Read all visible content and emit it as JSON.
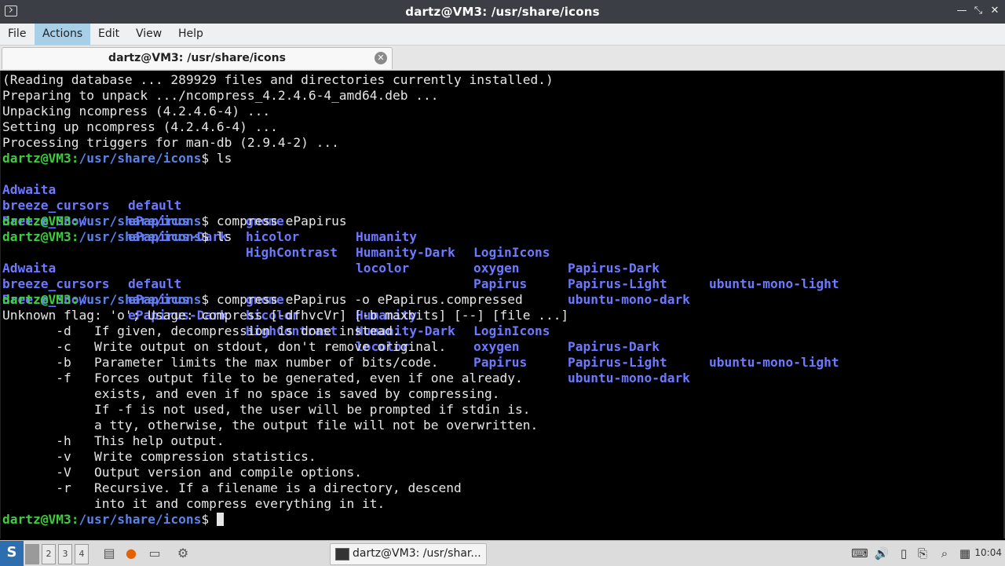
{
  "window": {
    "title": "dartz@VM3: /usr/share/icons"
  },
  "menu": [
    "File",
    "Actions",
    "Edit",
    "View",
    "Help"
  ],
  "tab": {
    "label": "dartz@VM3: /usr/share/icons"
  },
  "terminal": {
    "user_host": "dartz@VM3",
    "path": "/usr/share/icons",
    "output1": [
      "(Reading database ... 289929 files and directories currently installed.)",
      "Preparing to unpack .../ncompress_4.2.4.6-4_amd64.deb ...",
      "Unpacking ncompress (4.2.4.6-4) ...",
      "Setting up ncompress (4.2.4.6-4) ...",
      "Processing triggers for man-db (2.9.4-2) ..."
    ],
    "cmd_ls": "ls",
    "ls_rows": [
      [
        "Adwaita",
        "default",
        "gnome",
        "Humanity",
        "LoginIcons",
        "Papirus-Dark",
        "ubuntu-mono-light"
      ],
      [
        "breeze_cursors",
        "ePapirus",
        "hicolor",
        "Humanity-Dark",
        "oxygen",
        "Papirus-Light",
        ""
      ],
      [
        "Breeze_Snow",
        "ePapirus-Dark",
        "HighContrast",
        "locolor",
        "Papirus",
        "ubuntu-mono-dark",
        ""
      ]
    ],
    "cmd_compress1": "compress ePapirus",
    "cmd_compress2": "compress ePapirus -o ePapirus.compressed",
    "usage": [
      "Unknown flag: 'o'; Usage: compress [-dfhvcVr] [-b maxbits] [--] [file ...]",
      "       -d   If given, decompression is done instead.",
      "       -c   Write output on stdout, don't remove original.",
      "       -b   Parameter limits the max number of bits/code.",
      "       -f   Forces output file to be generated, even if one already.",
      "            exists, and even if no space is saved by compressing.",
      "            If -f is not used, the user will be prompted if stdin is.",
      "            a tty, otherwise, the output file will not be overwritten.",
      "       -h   This help output.",
      "       -v   Write compression statistics.",
      "       -V   Output version and compile options.",
      "       -r   Recursive. If a filename is a directory, descend",
      "            into it and compress everything in it."
    ]
  },
  "taskbar": {
    "desktops": [
      "",
      "2",
      "3",
      "4"
    ],
    "task_label": "dartz@VM3: /usr/shar...",
    "clock": "10:04"
  },
  "colors": {
    "prompt": "#3ccf3c",
    "path": "#5b83e8",
    "dir": "#6d79ff",
    "accent": "#a8cfe8"
  }
}
